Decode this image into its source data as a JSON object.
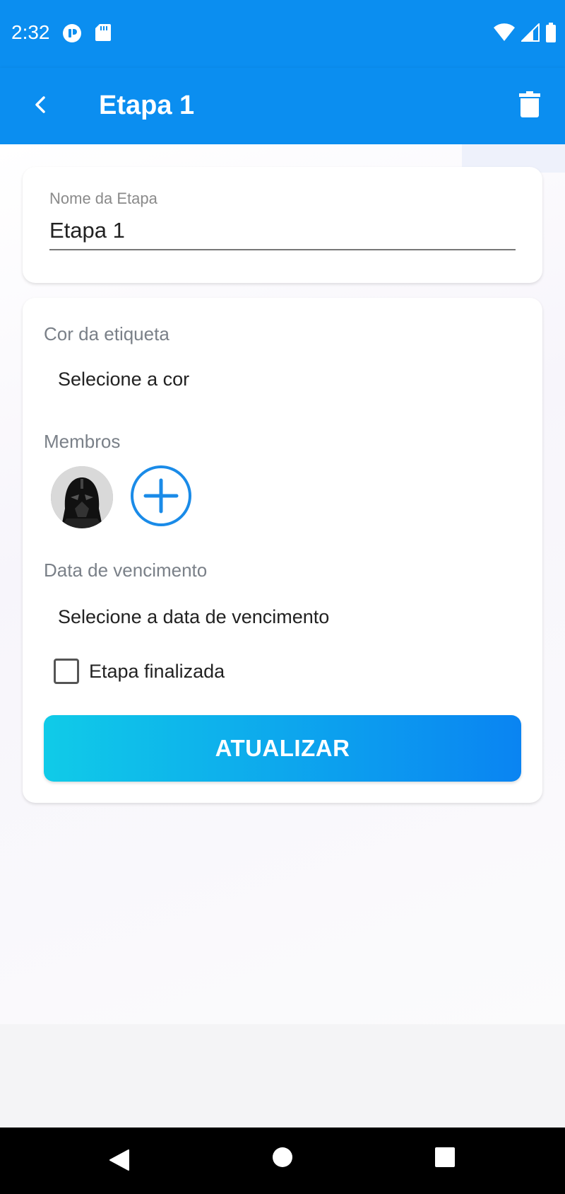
{
  "status_bar": {
    "time": "2:32",
    "icons": [
      "app-notification-icon",
      "sd-card-icon",
      "wifi-icon",
      "signal-icon",
      "battery-icon"
    ]
  },
  "app_bar": {
    "title": "Etapa 1",
    "back_icon": "chevron-left-icon",
    "delete_icon": "trash-icon",
    "color": "#0b8ef0"
  },
  "stage_name": {
    "label": "Nome da Etapa",
    "value": "Etapa 1"
  },
  "details": {
    "color_label": "Cor da etiqueta",
    "color_select": "Selecione a cor",
    "members_label": "Membros",
    "due_date_label": "Data de vencimento",
    "due_date_select": "Selecione a data de vencimento",
    "finished_label": "Etapa finalizada",
    "finished_checked": false,
    "update_button": "ATUALIZAR",
    "button_gradient": [
      "#10cbe8",
      "#0a84f2"
    ]
  },
  "nav_bar": {
    "icons": [
      "nav-back-icon",
      "nav-home-icon",
      "nav-recents-icon"
    ]
  }
}
